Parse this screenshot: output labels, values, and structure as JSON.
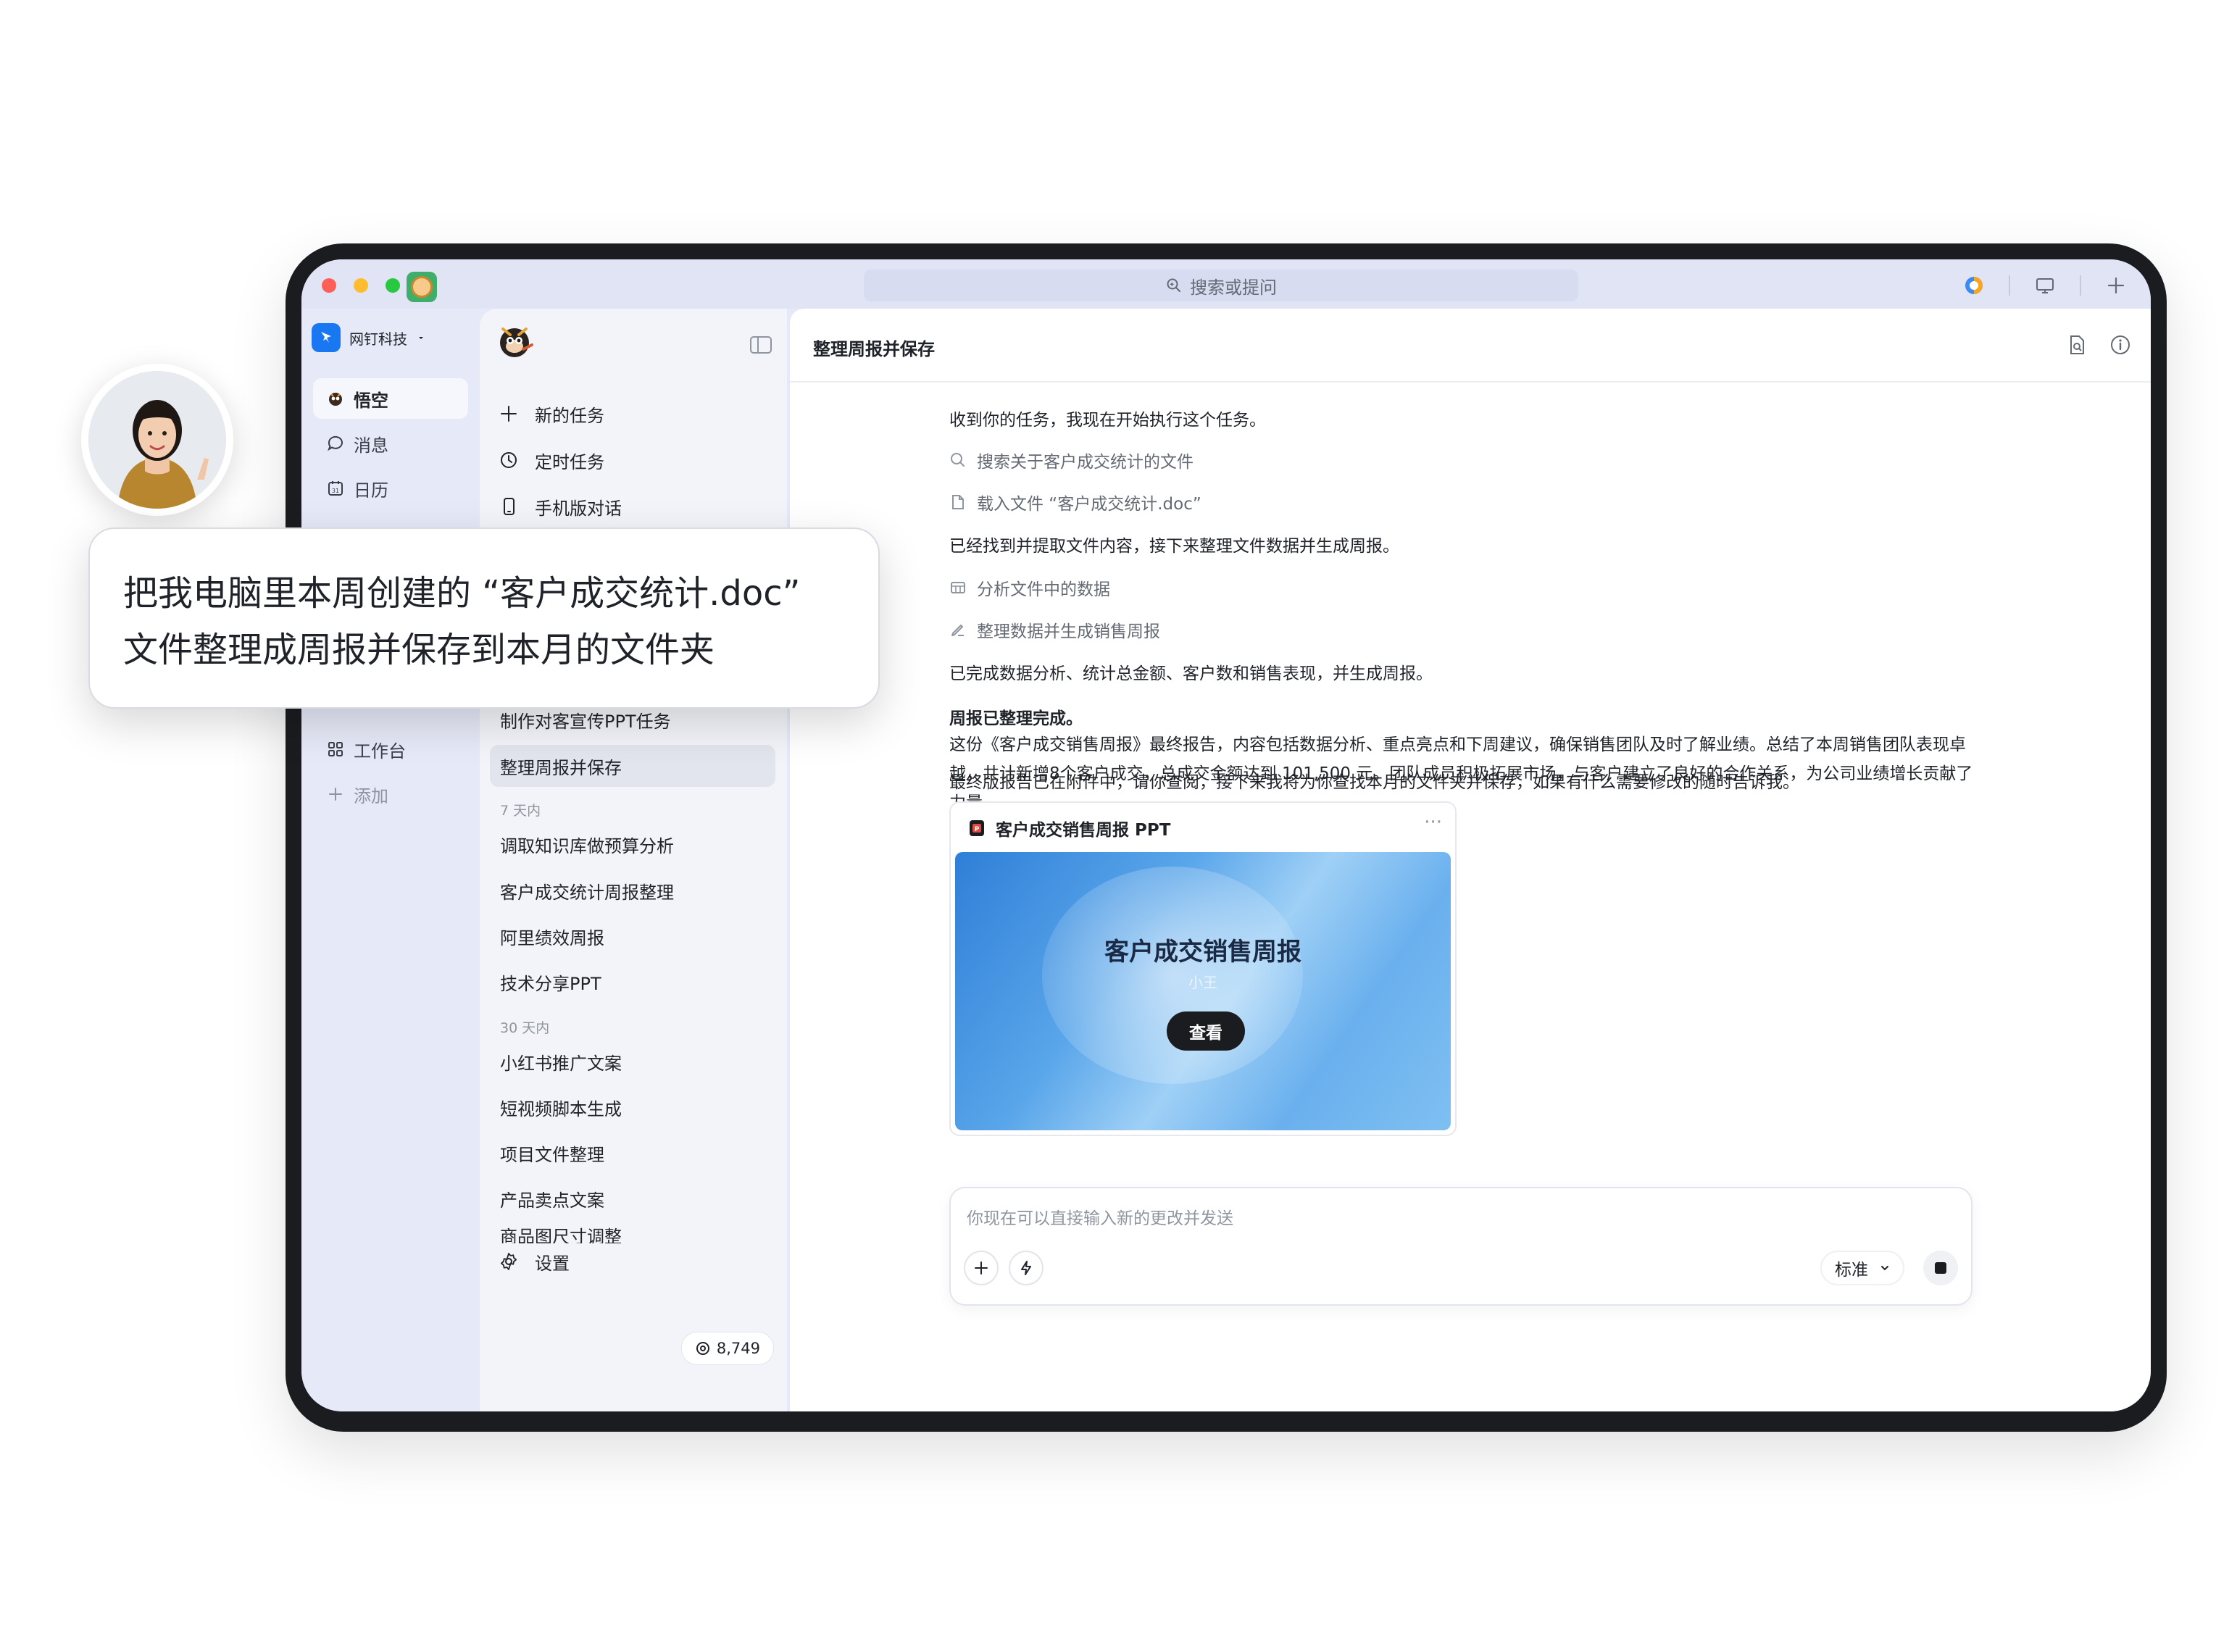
{
  "search": {
    "placeholder": "搜索或提问"
  },
  "org": {
    "name": "网钉科技"
  },
  "nav": [
    {
      "label": "悟空",
      "icon": "wukong-icon",
      "active": true
    },
    {
      "label": "消息",
      "icon": "message-icon"
    },
    {
      "label": "日历",
      "icon": "calendar-icon"
    },
    {
      "label": "工作台",
      "icon": "workbench-icon"
    },
    {
      "label": "添加",
      "icon": "add-icon"
    }
  ],
  "sidebar": {
    "actions": [
      {
        "label": "新的任务",
        "icon": "plus-icon"
      },
      {
        "label": "定时任务",
        "icon": "clock-icon"
      },
      {
        "label": "手机版对话",
        "icon": "phone-icon"
      }
    ],
    "recent_items": [
      "制作对客宣传PPT任务",
      "整理周报并保存"
    ],
    "group_7": "7 天内",
    "items_7": [
      "调取知识库做预算分析",
      "客户成交统计周报整理",
      "阿里绩效周报",
      "技术分享PPT"
    ],
    "group_30": "30 天内",
    "items_30": [
      "小红书推广文案",
      "短视频脚本生成",
      "项目文件整理",
      "产品卖点文案",
      "商品图尺寸调整"
    ],
    "settings_label": "设置",
    "points": "8,749"
  },
  "chat": {
    "title": "整理周报并保存",
    "lines": {
      "intro": "收到你的任务，我现在开始执行这个任务。",
      "step1": "搜索关于客户成交统计的文件",
      "step2": "载入文件 “客户成交统计.doc”",
      "found": "已经找到并提取文件内容，接下来整理文件数据并生成周报。",
      "step3": "分析文件中的数据",
      "step4": "整理数据并生成销售周报",
      "done": "已完成数据分析、统计总金额、客户数和销售表现，并生成周报。",
      "report_done": "周报已整理完成。",
      "summary": "这份《客户成交销售周报》最终报告，内容包括数据分析、重点亮点和下周建议，确保销售团队及时了解业绩。总结了本周销售团队表现卓越，共计新增8个客户成交，总成交金额达到 101,500 元。团队成员积极拓展市场，与客户建立了良好的合作关系，为公司业绩增长贡献了力量。",
      "final": "最终版报告已在附件中，请你查阅，接下来我将为你查找本月的文件夹并保存，如果有什么需要修改的随时告诉我。"
    },
    "attachment": {
      "name": "客户成交销售周报 PPT",
      "more": "···",
      "preview_title": "客户成交销售周报",
      "preview_author": "小王",
      "view_label": "查看"
    },
    "composer": {
      "placeholder": "你现在可以直接输入新的更改并发送",
      "mode": "标准"
    }
  },
  "bubble": {
    "line1": "把我电脑里本周创建的 “客户成交统计.doc”",
    "line2": "文件整理成周报并保存到本月的文件夹"
  }
}
